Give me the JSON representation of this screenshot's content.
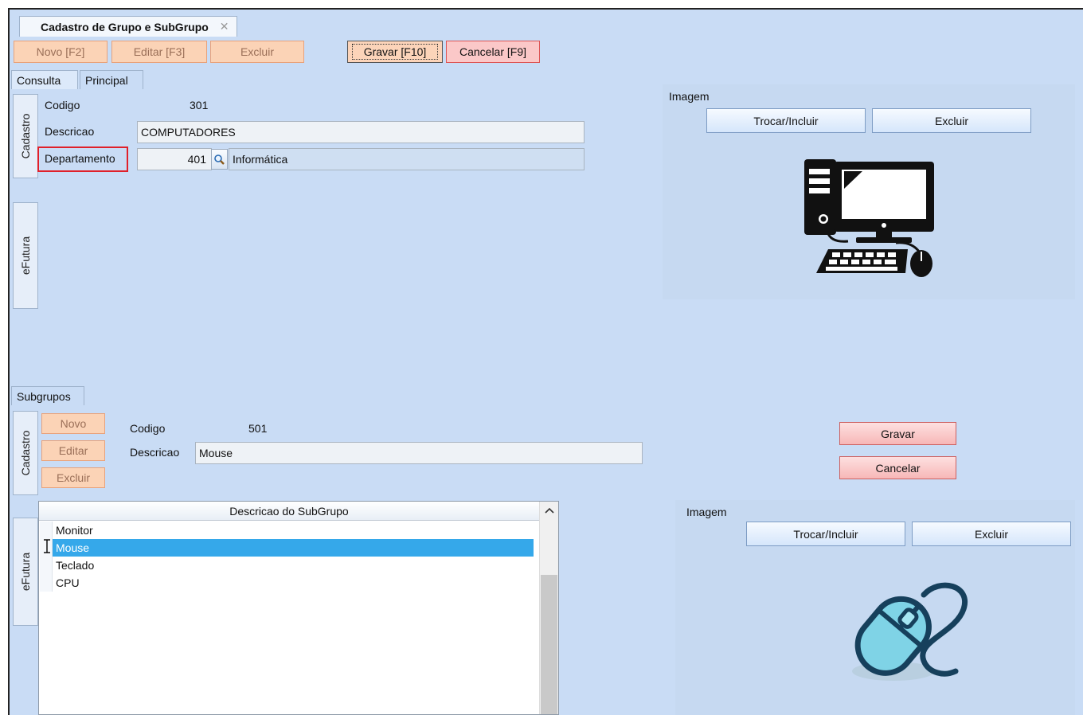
{
  "window": {
    "tab_title": "Cadastro de Grupo e SubGrupo",
    "close_symbol": "✕"
  },
  "toolbar": {
    "novo": "Novo [F2]",
    "editar": "Editar [F3]",
    "excluir": "Excluir",
    "gravar": "Gravar [F10]",
    "cancelar": "Cancelar [F9]"
  },
  "page_tabs": {
    "consulta": "Consulta",
    "principal": "Principal"
  },
  "side_tabs": {
    "cadastro": "Cadastro",
    "efutura": "eFutura"
  },
  "grupo": {
    "codigo_label": "Codigo",
    "codigo_value": "301",
    "descricao_label": "Descricao",
    "descricao_value": "COMPUTADORES",
    "departamento_label": "Departamento",
    "departamento_code": "401",
    "departamento_name": "Informática",
    "imagem_label": "Imagem",
    "trocar_label": "Trocar/Incluir",
    "excluir_label": "Excluir"
  },
  "subgrupos": {
    "tab_label": "Subgrupos",
    "novo": "Novo",
    "editar": "Editar",
    "excluir": "Excluir",
    "codigo_label": "Codigo",
    "codigo_value": "501",
    "descricao_label": "Descricao",
    "descricao_value": "Mouse",
    "gravar": "Gravar",
    "cancelar": "Cancelar",
    "grid_header": "Descricao do SubGrupo",
    "rows": [
      "Monitor",
      "Mouse",
      "Teclado",
      "CPU"
    ],
    "selected_row": "Mouse",
    "imagem_label": "Imagem",
    "trocar_label": "Trocar/Incluir",
    "excluir_label": "Excluir"
  },
  "icons": {
    "lookup": "magnifier-icon",
    "computer_image": "computer-icon",
    "mouse_image": "mouse-icon",
    "text_cursor": "text-cursor-icon",
    "scroll_up": "chevron-up-icon"
  },
  "colors": {
    "background": "#c9dcf5",
    "toolbar_button": "#fbd3b6",
    "danger_button": "#fbc8c8",
    "selection": "#35a8ea",
    "highlight_box": "#e0202a"
  }
}
